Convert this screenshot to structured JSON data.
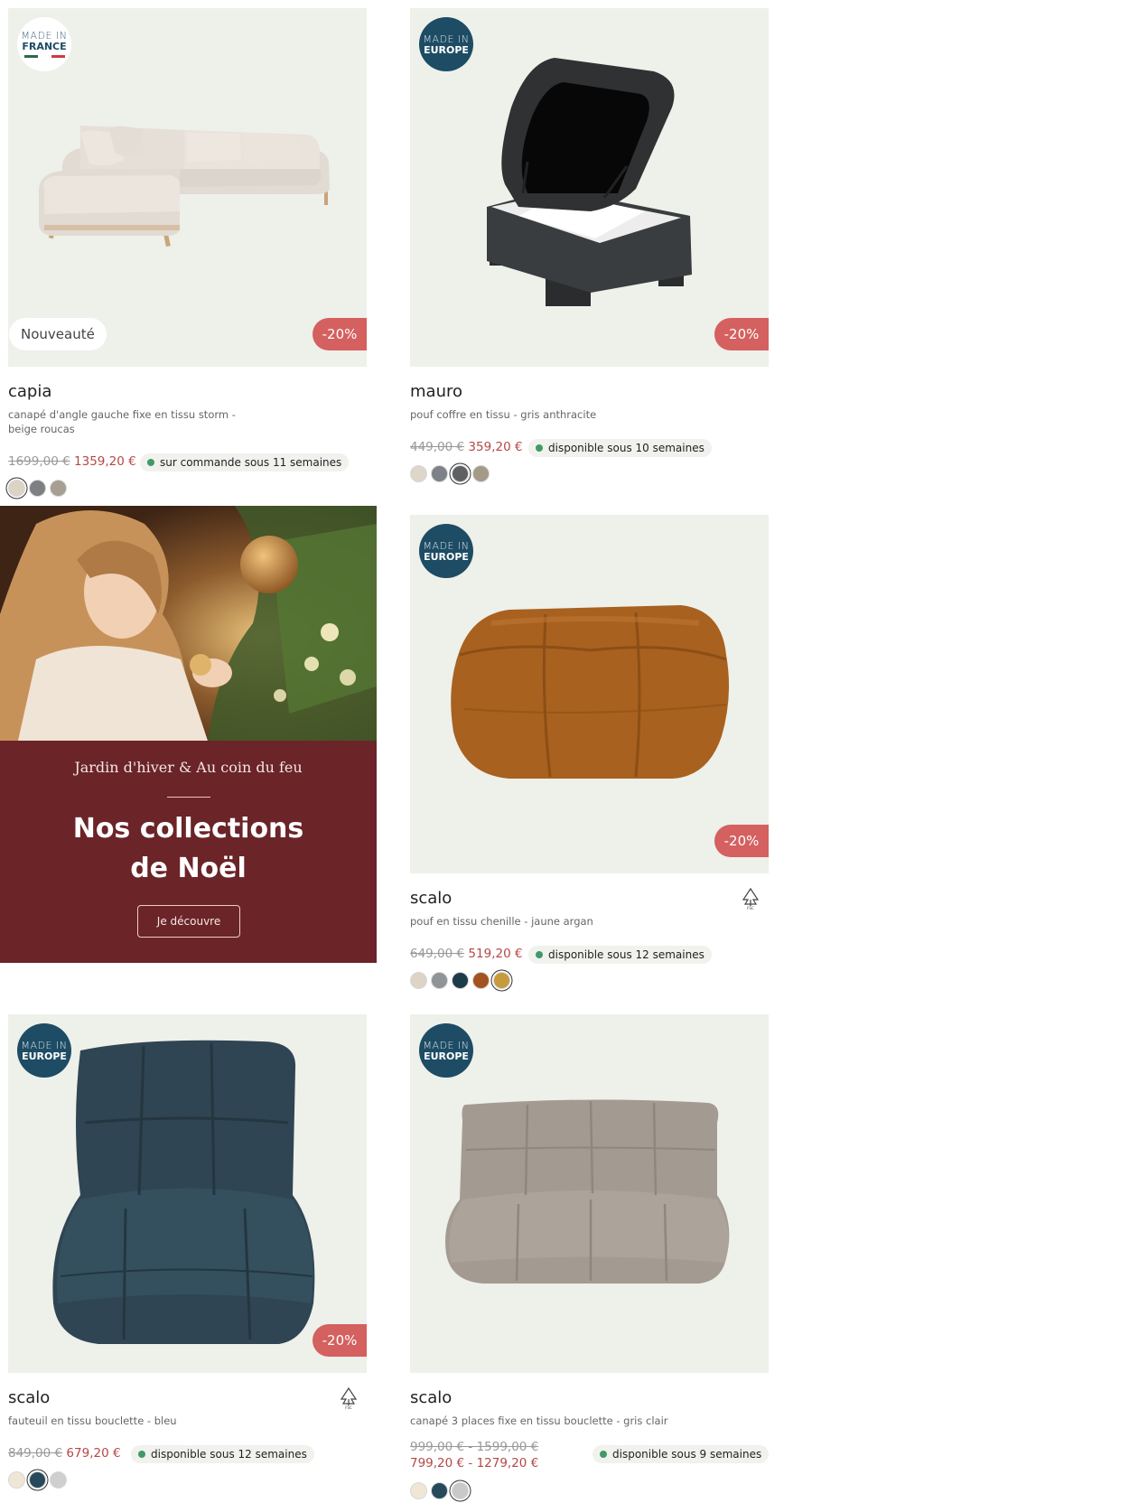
{
  "products": [
    {
      "origin_top": "MADE IN",
      "origin_bottom": "FRANCE",
      "tag": "Nouveauté",
      "discount": "-20%",
      "title": "capia",
      "desc": "canapé d'angle gauche fixe en tissu storm - beige roucas",
      "old_price": "1699,00 €",
      "new_price": "1359,20 €",
      "availability": "sur commande sous 11 semaines",
      "swatches": [
        "#dcd3c4",
        "#7d7f82",
        "#a79f91"
      ],
      "selected_swatch": 0
    },
    {
      "origin_top": "MADE IN",
      "origin_bottom": "EUROPE",
      "discount": "-20%",
      "title": "mauro",
      "desc": "pouf coffre en tissu - gris anthracite",
      "old_price": "449,00 €",
      "new_price": "359,20 €",
      "availability": "disponible sous 10 semaines",
      "swatches": [
        "#ded6c8",
        "#7d8289",
        "#5f6061",
        "#a39a88"
      ],
      "selected_swatch": 2
    },
    {
      "origin_top": "MADE IN",
      "origin_bottom": "EUROPE",
      "discount": "-20%",
      "title": "scalo",
      "desc": "pouf en tissu chenille - jaune argan",
      "old_price": "649,00 €",
      "new_price": "519,20 €",
      "availability": "disponible sous 12 semaines",
      "swatches": [
        "#ddd3c6",
        "#8e9498",
        "#1e3b4a",
        "#a4521f",
        "#c79a3c"
      ],
      "selected_swatch": 4
    },
    {
      "origin_top": "MADE IN",
      "origin_bottom": "EUROPE",
      "discount": "-20%",
      "title": "scalo",
      "desc": "fauteuil en tissu bouclette - bleu",
      "old_price": "849,00 €",
      "new_price": "679,20 €",
      "availability": "disponible sous 12 semaines",
      "swatches": [
        "#efe6d6",
        "#27495c",
        "#cfcfcf"
      ],
      "selected_swatch": 1
    },
    {
      "origin_top": "MADE IN",
      "origin_bottom": "EUROPE",
      "title": "scalo",
      "desc": "canapé 3 places fixe en tissu bouclette - gris clair",
      "old_price": "999,00 € - 1599,00 €",
      "new_price": "799,20 € - 1279,20 €",
      "availability": "disponible sous 9 semaines",
      "swatches": [
        "#efe6d6",
        "#27495c",
        "#c9c9c9"
      ],
      "selected_swatch": 2
    }
  ],
  "promo": {
    "subtitle": "Jardin d'hiver & Au coin du feu",
    "title_line1": "Nos collections",
    "title_line2": "de Noël",
    "button": "Je découvre"
  },
  "colors": {
    "accent_discount": "#d4605f",
    "price_new": "#b44845",
    "availability_dot": "#3f9a67",
    "origin_badge": "#1d4c64",
    "promo_bg": "#6b2428",
    "image_bg": "#eef0ea"
  },
  "icons": [
    "fsc-tree-icon"
  ]
}
